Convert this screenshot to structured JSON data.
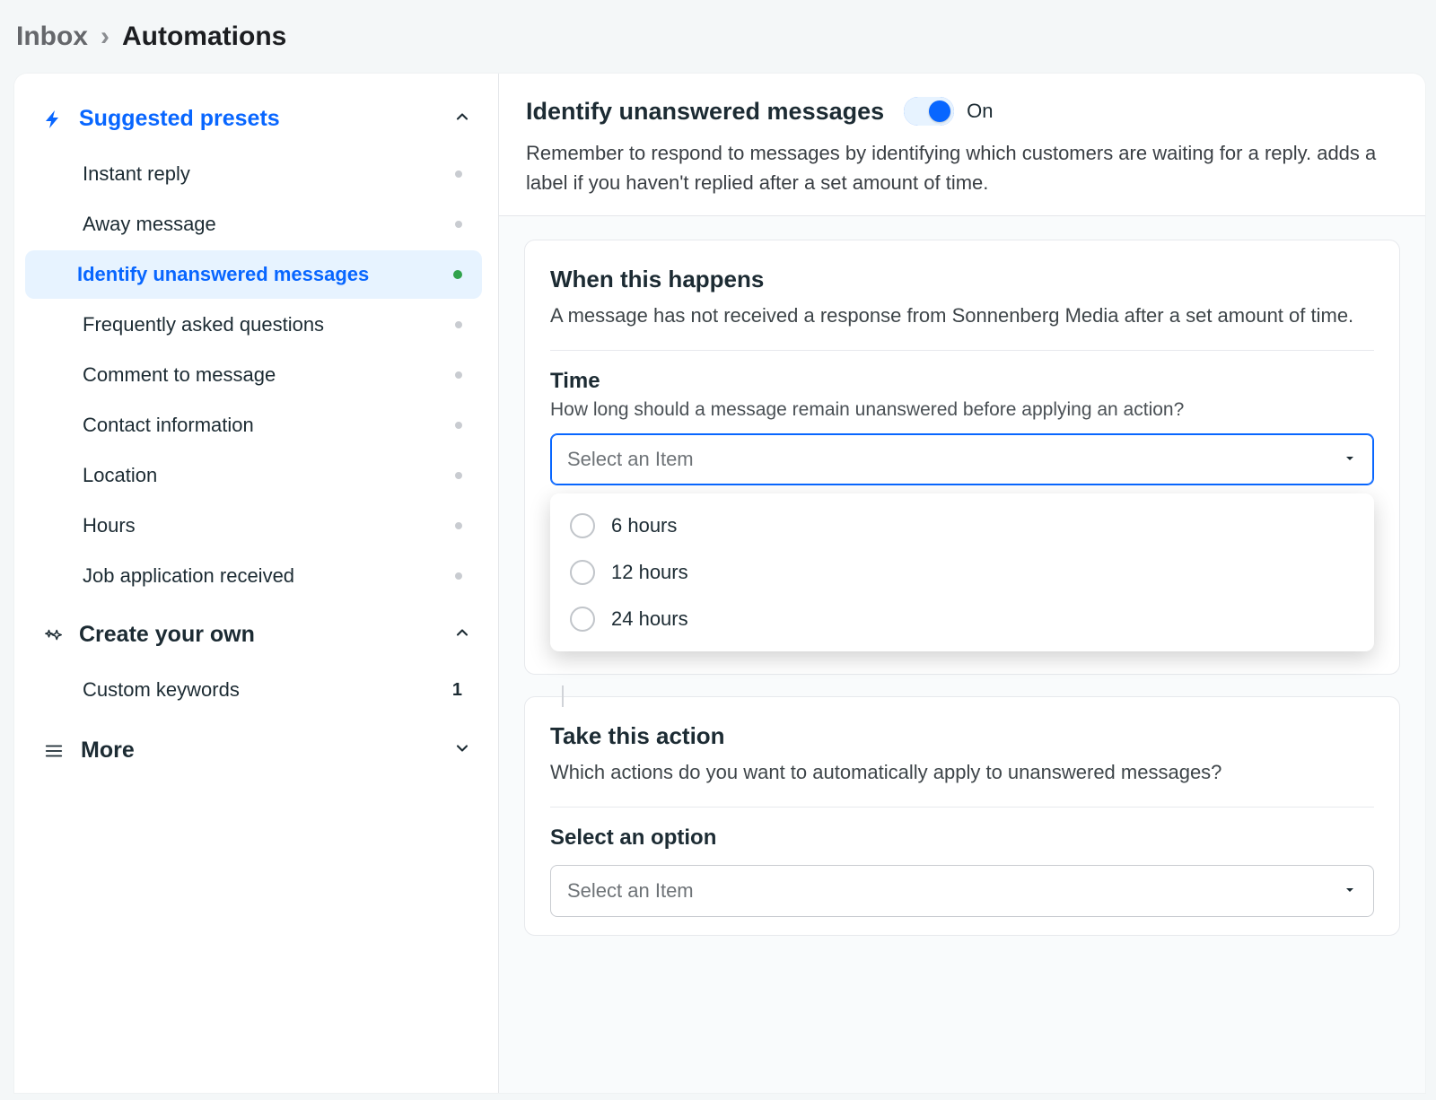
{
  "breadcrumb": {
    "prev": "Inbox",
    "current": "Automations"
  },
  "sidebar": {
    "sections": {
      "presets": {
        "title": "Suggested presets",
        "items": [
          {
            "label": "Instant reply",
            "status": "off"
          },
          {
            "label": "Away message",
            "status": "off"
          },
          {
            "label": "Identify unanswered messages",
            "status": "on",
            "selected": true
          },
          {
            "label": "Frequently asked questions",
            "status": "off"
          },
          {
            "label": "Comment to message",
            "status": "off"
          },
          {
            "label": "Contact information",
            "status": "off"
          },
          {
            "label": "Location",
            "status": "off"
          },
          {
            "label": "Hours",
            "status": "off"
          },
          {
            "label": "Job application received",
            "status": "off"
          }
        ]
      },
      "create": {
        "title": "Create your own",
        "items": [
          {
            "label": "Custom keywords",
            "count": "1"
          }
        ]
      },
      "more": {
        "title": "More"
      }
    }
  },
  "main": {
    "title": "Identify unanswered messages",
    "toggle": {
      "state_label": "On"
    },
    "description": "Remember to respond to messages by identifying which customers are waiting for a reply. adds a label if you haven't replied after a set amount of time.",
    "when": {
      "heading": "When this happens",
      "description": "A message has not received a response from Sonnenberg Media after a set amount of time.",
      "time_label": "Time",
      "time_help": "How long should a message remain unanswered before applying an action?",
      "select_placeholder": "Select an Item",
      "options": [
        {
          "label": "6 hours"
        },
        {
          "label": "12 hours"
        },
        {
          "label": "24 hours"
        }
      ]
    },
    "action": {
      "heading": "Take this action",
      "description": "Which actions do you want to automatically apply to unanswered messages?",
      "option_label": "Select an option",
      "select_placeholder": "Select an Item"
    }
  }
}
